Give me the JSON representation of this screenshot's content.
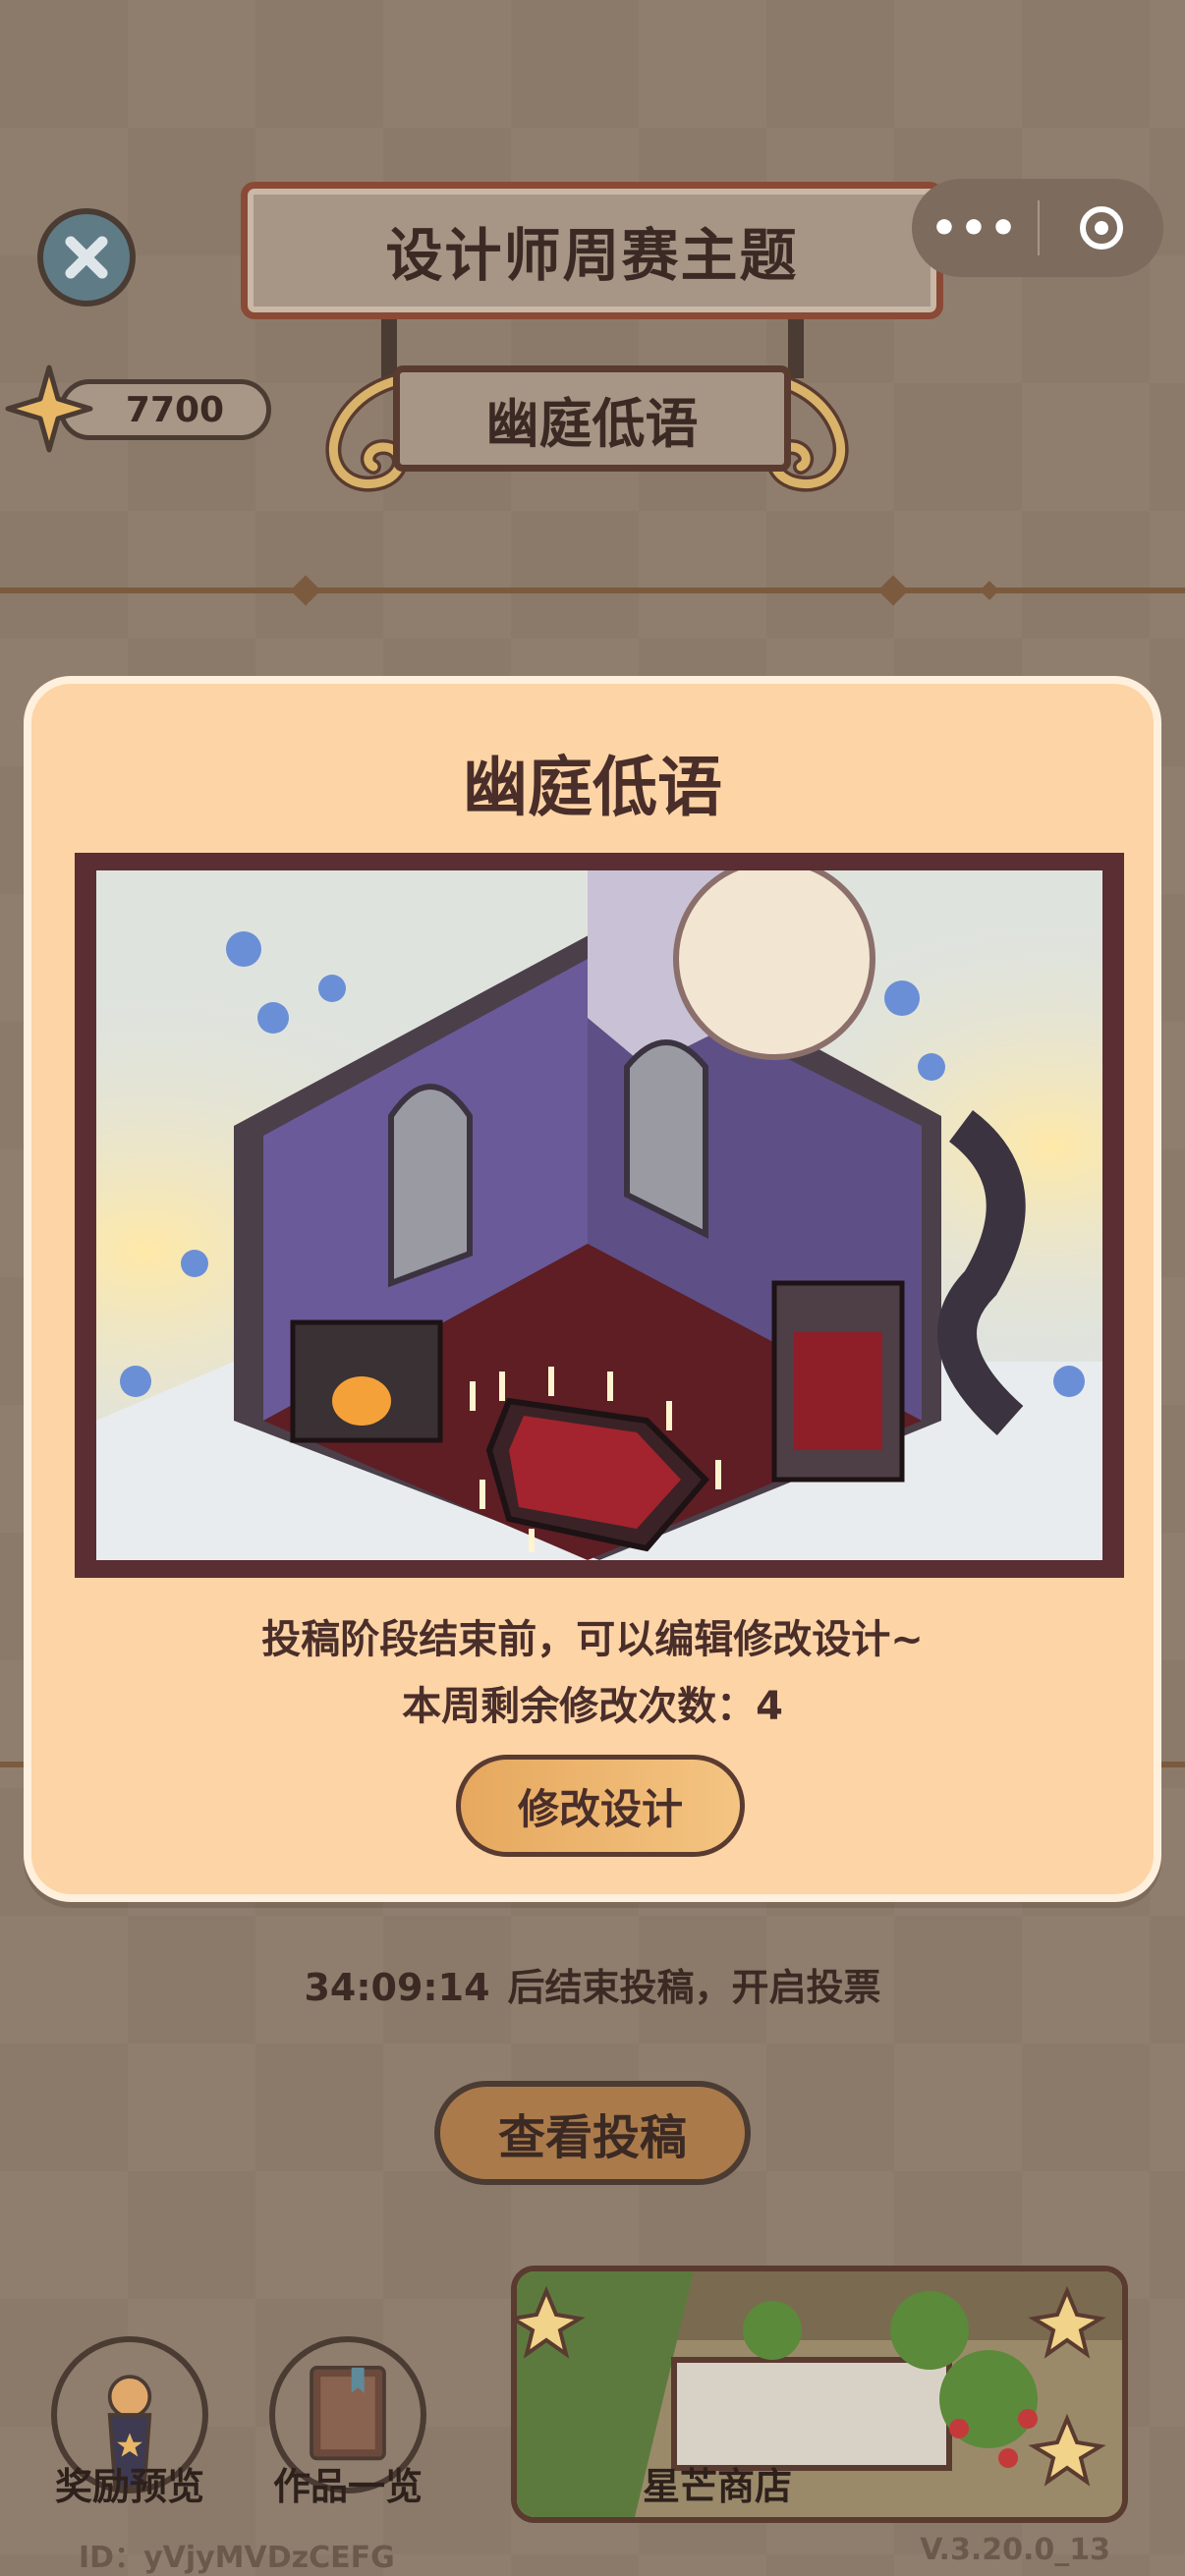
{
  "header": {
    "title": "设计师周赛主题",
    "theme_name": "幽庭低语",
    "more_label": "•••",
    "star_count": "7700"
  },
  "modal": {
    "title": "幽庭低语",
    "edit_note": "投稿阶段结束前，可以编辑修改设计~",
    "remaining_edits": "本周剩余修改次数：4",
    "modify_button": "修改设计"
  },
  "countdown": {
    "time": "34:09:14",
    "text": "后结束投稿，开启投票"
  },
  "actions": {
    "view_submissions": "查看投稿",
    "rewards_preview": "奖励预览",
    "works_overview": "作品一览",
    "shop": "星芒商店"
  },
  "footer": {
    "id": "ID：yVjyMVDzCEFG",
    "version": "V.3.20.0_13"
  },
  "colors": {
    "modal_bg": "#fdd4a6",
    "frame": "#5a2e33",
    "text_dark": "#4a2e2a",
    "button_gold": "#e6a85e"
  },
  "icons": [
    "close-icon",
    "more-icon",
    "target-icon",
    "star-icon",
    "trophy-icon",
    "book-icon"
  ]
}
